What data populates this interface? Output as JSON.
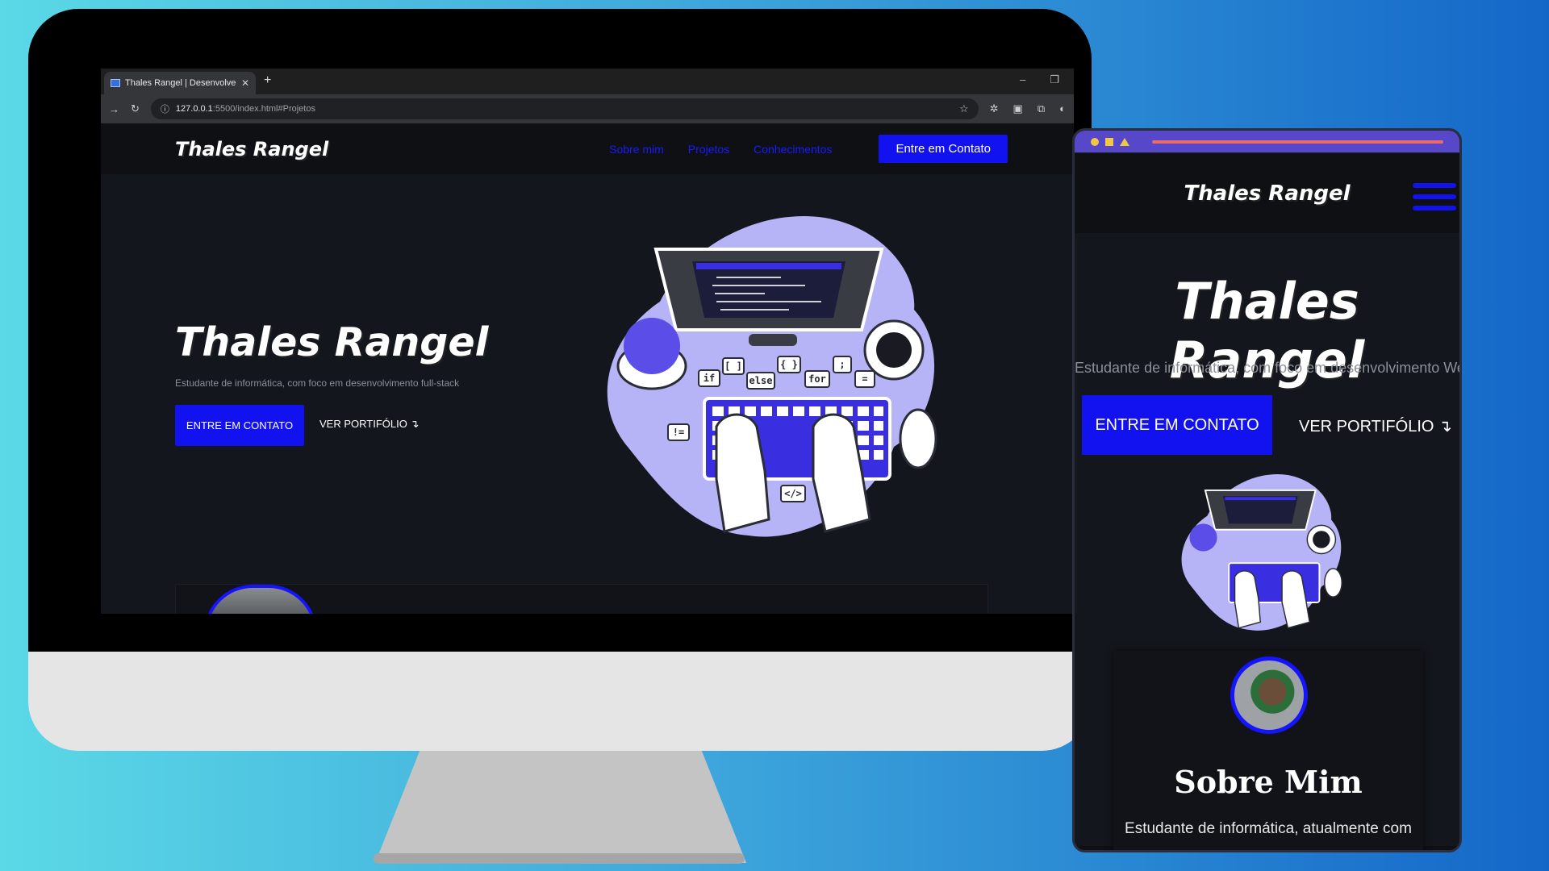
{
  "browser": {
    "tab_title": "Thales Rangel | Desenvolvedor",
    "tab_close": "✕",
    "new_tab": "+",
    "minimize": "–",
    "restore": "❐",
    "url_host": "127.0.0.1",
    "url_path": ":5500/index.html#Projetos"
  },
  "desktop": {
    "brand": "Thales Rangel",
    "nav": [
      "Sobre mim",
      "Projetos",
      "Conhecimentos"
    ],
    "nav_cta": "Entre em Contato",
    "hero_title": "Thales Rangel",
    "hero_subtitle": "Estudante de informática, com foco em desenvolvimento full-stack",
    "btn_contact": "ENTRE EM CONTATO",
    "btn_portfolio": "VER PORTIFÓLIO ↴"
  },
  "mobile": {
    "brand": "Thales Rangel",
    "hero_title": "Thales Rangel",
    "hero_subtitle": "Estudante de informática, com foco em desenvolvimento Web",
    "btn_contact": "ENTRE EM CONTATO",
    "btn_portfolio": "VER PORTIFÓLIO ↴",
    "about_title": "Sobre Mim",
    "about_text": "Estudante de informática, atualmente com"
  },
  "illustration": {
    "code_bubbles": [
      "if",
      "[ ]",
      "else",
      "{ }",
      "for",
      ";",
      "=",
      "!=",
      "</>"
    ]
  },
  "colors": {
    "accent": "#1212f0",
    "page_bg": "#14161d",
    "illustration": "#b7b3f7",
    "phone_topbar": "#5648c8"
  }
}
